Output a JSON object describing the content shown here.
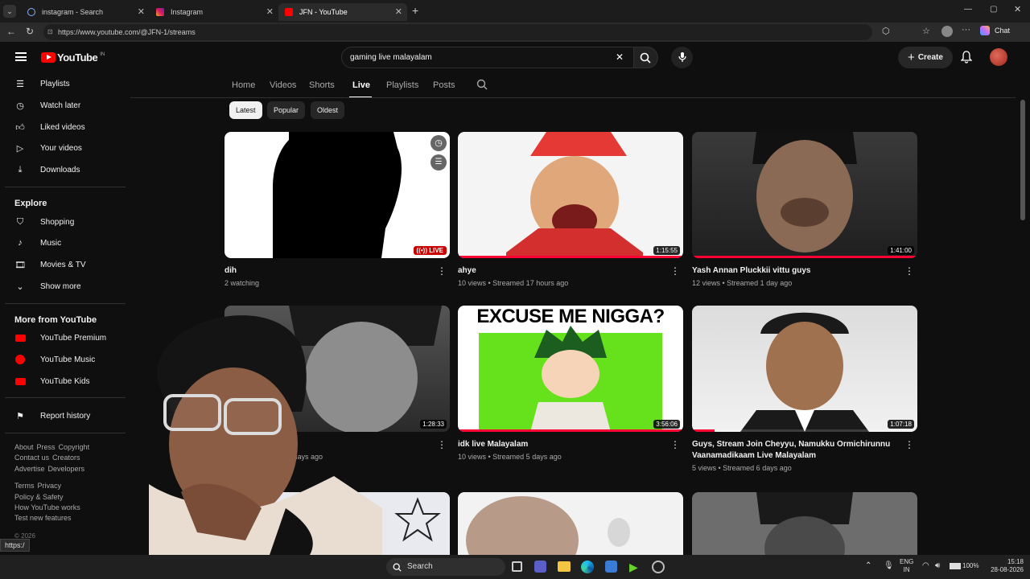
{
  "browser": {
    "tabs": [
      {
        "title": "instagram - Search",
        "active": false
      },
      {
        "title": "Instagram",
        "active": false
      },
      {
        "title": "JFN - YouTube",
        "active": true
      }
    ],
    "url": "https://www.youtube.com/@JFN-1/streams",
    "chat_label": "Chat",
    "status_url": "https:/"
  },
  "masthead": {
    "logo": "YouTube",
    "region": "IN",
    "search_value": "gaming live malayalam",
    "create_label": "Create"
  },
  "sidebar": {
    "you_items": [
      {
        "label": "Playlists",
        "icon": "playlist-icon"
      },
      {
        "label": "Watch later",
        "icon": "clock-icon"
      },
      {
        "label": "Liked videos",
        "icon": "thumbs-up-icon"
      },
      {
        "label": "Your videos",
        "icon": "video-icon"
      },
      {
        "label": "Downloads",
        "icon": "download-icon"
      }
    ],
    "explore_heading": "Explore",
    "explore_items": [
      {
        "label": "Shopping",
        "icon": "bag-icon"
      },
      {
        "label": "Music",
        "icon": "music-icon"
      },
      {
        "label": "Movies & TV",
        "icon": "film-icon"
      },
      {
        "label": "Show more",
        "icon": "chevron-down-icon"
      }
    ],
    "more_heading": "More from YouTube",
    "more_items": [
      {
        "label": "YouTube Premium"
      },
      {
        "label": "YouTube Music"
      },
      {
        "label": "YouTube Kids"
      }
    ],
    "report_history": "Report history",
    "footer_row1": [
      "About",
      "Press",
      "Copyright"
    ],
    "footer_row2": [
      "Contact us",
      "Creators"
    ],
    "footer_row3": [
      "Advertise",
      "Developers"
    ],
    "footer_row4": [
      "Terms",
      "Privacy"
    ],
    "footer_row5": "Policy & Safety",
    "footer_row6": "How YouTube works",
    "footer_row7": "Test new features",
    "copyright": "© 2026"
  },
  "channel_tabs": [
    "Home",
    "Videos",
    "Shorts",
    "Live",
    "Playlists",
    "Posts"
  ],
  "active_tab": "Live",
  "chips": [
    "Latest",
    "Popular",
    "Oldest"
  ],
  "videos": [
    {
      "title": "dih",
      "meta": "2 watching",
      "badge": "LIVE",
      "progress": 0
    },
    {
      "title": "ahye",
      "meta": "10 views • Streamed 17 hours ago",
      "badge": "1:15:55",
      "progress": 1
    },
    {
      "title": "Yash Annan Pluckkii vittu guys",
      "meta": "12 views • Streamed 1 day ago",
      "badge": "1:41:00",
      "progress": 1
    },
    {
      "title": "",
      "meta": "med 3 days ago",
      "badge": "1:28:33",
      "progress": 0
    },
    {
      "title": "idk live Malayalam",
      "meta": "10 views • Streamed 5 days ago",
      "badge": "3:56:06",
      "progress": 1,
      "thumb_text": "EXCUSE ME NIGGA?"
    },
    {
      "title": "Guys, Stream Join Cheyyu, Namukku Ormichirunnu Vaanamadikaam Live Malayalam",
      "meta": "5 views • Streamed 6 days ago",
      "badge": "1:07:18",
      "progress": 0.1
    }
  ],
  "taskbar": {
    "search_label": "Search",
    "lang": "ENG",
    "region": "IN",
    "battery": "100%",
    "time": "15:18",
    "date": "28-08-2026"
  },
  "colors": {
    "background": "#0f0f0f",
    "accent_red": "#ff0033",
    "live_red": "#cc0000"
  }
}
